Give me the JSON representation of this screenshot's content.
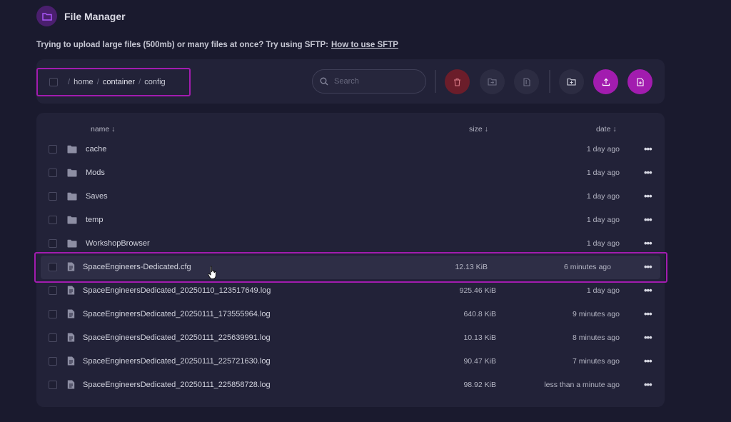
{
  "header": {
    "title": "File Manager",
    "logo_icon": "folder-open-icon"
  },
  "notice": {
    "text": "Trying to upload large files (500mb) or many files at once? Try using SFTP:",
    "link": "How to use SFTP"
  },
  "breadcrumb": {
    "items": [
      "home",
      "container",
      "config"
    ]
  },
  "search": {
    "placeholder": "Search"
  },
  "toolbar": {
    "buttons": [
      {
        "name": "delete",
        "icon": "trash-icon",
        "color": "#6b1d2a"
      },
      {
        "name": "move",
        "icon": "folder-move-icon",
        "color": "#2c2c42"
      },
      {
        "name": "compress",
        "icon": "archive-icon",
        "color": "#2c2c42"
      },
      {
        "name": "new-folder",
        "icon": "folder-plus-icon",
        "color": "#2c2c42"
      },
      {
        "name": "upload",
        "icon": "upload-icon",
        "color": "#a21caf"
      },
      {
        "name": "new-file",
        "icon": "file-plus-icon",
        "color": "#a21caf"
      }
    ]
  },
  "table": {
    "columns": {
      "name": "name ↓",
      "size": "size ↓",
      "date": "date ↓"
    },
    "rows": [
      {
        "type": "folder",
        "name": "cache",
        "size": "",
        "date": "1 day ago"
      },
      {
        "type": "folder",
        "name": "Mods",
        "size": "",
        "date": "1 day ago"
      },
      {
        "type": "folder",
        "name": "Saves",
        "size": "",
        "date": "1 day ago"
      },
      {
        "type": "folder",
        "name": "temp",
        "size": "",
        "date": "1 day ago"
      },
      {
        "type": "folder",
        "name": "WorkshopBrowser",
        "size": "",
        "date": "1 day ago"
      },
      {
        "type": "file",
        "name": "SpaceEngineers-Dedicated.cfg",
        "size": "12.13 KiB",
        "date": "6 minutes ago"
      },
      {
        "type": "file",
        "name": "SpaceEngineersDedicated_20250110_123517649.log",
        "size": "925.46 KiB",
        "date": "1 day ago"
      },
      {
        "type": "file",
        "name": "SpaceEngineersDedicated_20250111_173555964.log",
        "size": "640.8 KiB",
        "date": "9 minutes ago"
      },
      {
        "type": "file",
        "name": "SpaceEngineersDedicated_20250111_225639991.log",
        "size": "10.13 KiB",
        "date": "8 minutes ago"
      },
      {
        "type": "file",
        "name": "SpaceEngineersDedicated_20250111_225721630.log",
        "size": "90.47 KiB",
        "date": "7 minutes ago"
      },
      {
        "type": "file",
        "name": "SpaceEngineersDedicated_20250111_225858728.log",
        "size": "98.92 KiB",
        "date": "less than a minute ago"
      }
    ],
    "more_label": "•••",
    "highlighted_row": 5
  },
  "colors": {
    "background": "#1a1a2e",
    "card": "#222238",
    "accent": "#a21caf",
    "danger": "#6b1d2a"
  }
}
